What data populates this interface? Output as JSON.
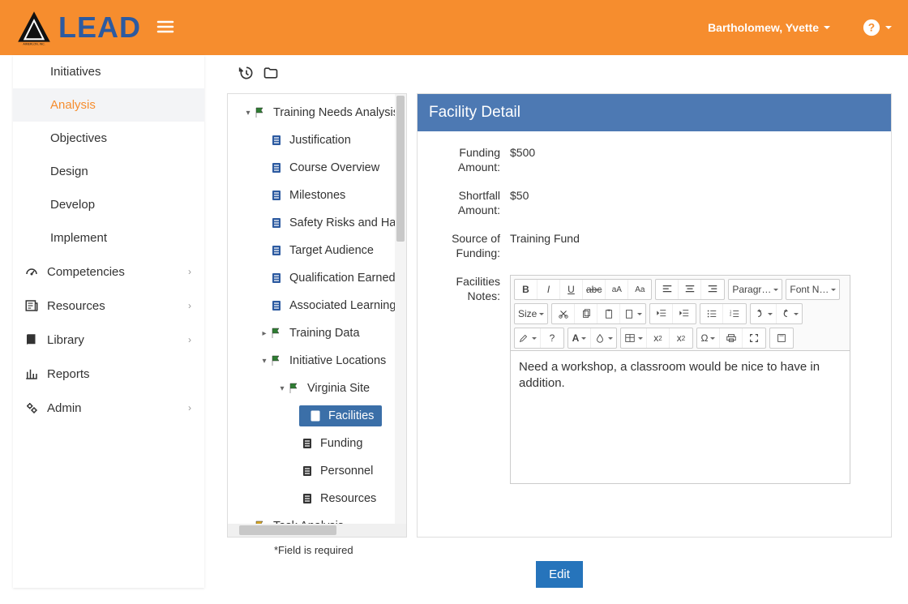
{
  "header": {
    "brand": "LEAD",
    "user": "Bartholomew, Yvette"
  },
  "sidebar": {
    "top": [
      {
        "label": "Initiatives"
      },
      {
        "label": "Analysis",
        "active": true
      },
      {
        "label": "Objectives"
      },
      {
        "label": "Design"
      },
      {
        "label": "Develop"
      },
      {
        "label": "Implement"
      }
    ],
    "sections": [
      {
        "label": "Competencies",
        "icon": "gauge"
      },
      {
        "label": "Resources",
        "icon": "news"
      },
      {
        "label": "Library",
        "icon": "book"
      },
      {
        "label": "Reports",
        "icon": "chart"
      },
      {
        "label": "Admin",
        "icon": "gears"
      }
    ]
  },
  "tree": {
    "root": "Training Needs Analysis",
    "docs": [
      "Justification",
      "Course Overview",
      "Milestones",
      "Safety Risks and Haza",
      "Target Audience",
      "Qualification Earned",
      "Associated Learning E"
    ],
    "training_data": "Training Data",
    "initiative_locations": "Initiative Locations",
    "site": "Virginia Site",
    "site_children": [
      {
        "label": "Facilities",
        "selected": true
      },
      {
        "label": "Funding"
      },
      {
        "label": "Personnel"
      },
      {
        "label": "Resources"
      }
    ],
    "task_analysis": "Task Analysis"
  },
  "detail": {
    "title": "Facility Detail",
    "funding_label": "Funding Amount:",
    "funding_value": "$500",
    "shortfall_label": "Shortfall Amount:",
    "shortfall_value": "$50",
    "source_label": "Source of Funding:",
    "source_value": "Training Fund",
    "notes_label": "Facilities Notes:",
    "notes_value": "Need a workshop, a classroom would be nice to have in addition.",
    "required_note": "*Field is required",
    "edit": "Edit"
  },
  "editor_toolbar": {
    "paragraph": "Paragr…",
    "font": "Font N…",
    "size": "Size"
  }
}
